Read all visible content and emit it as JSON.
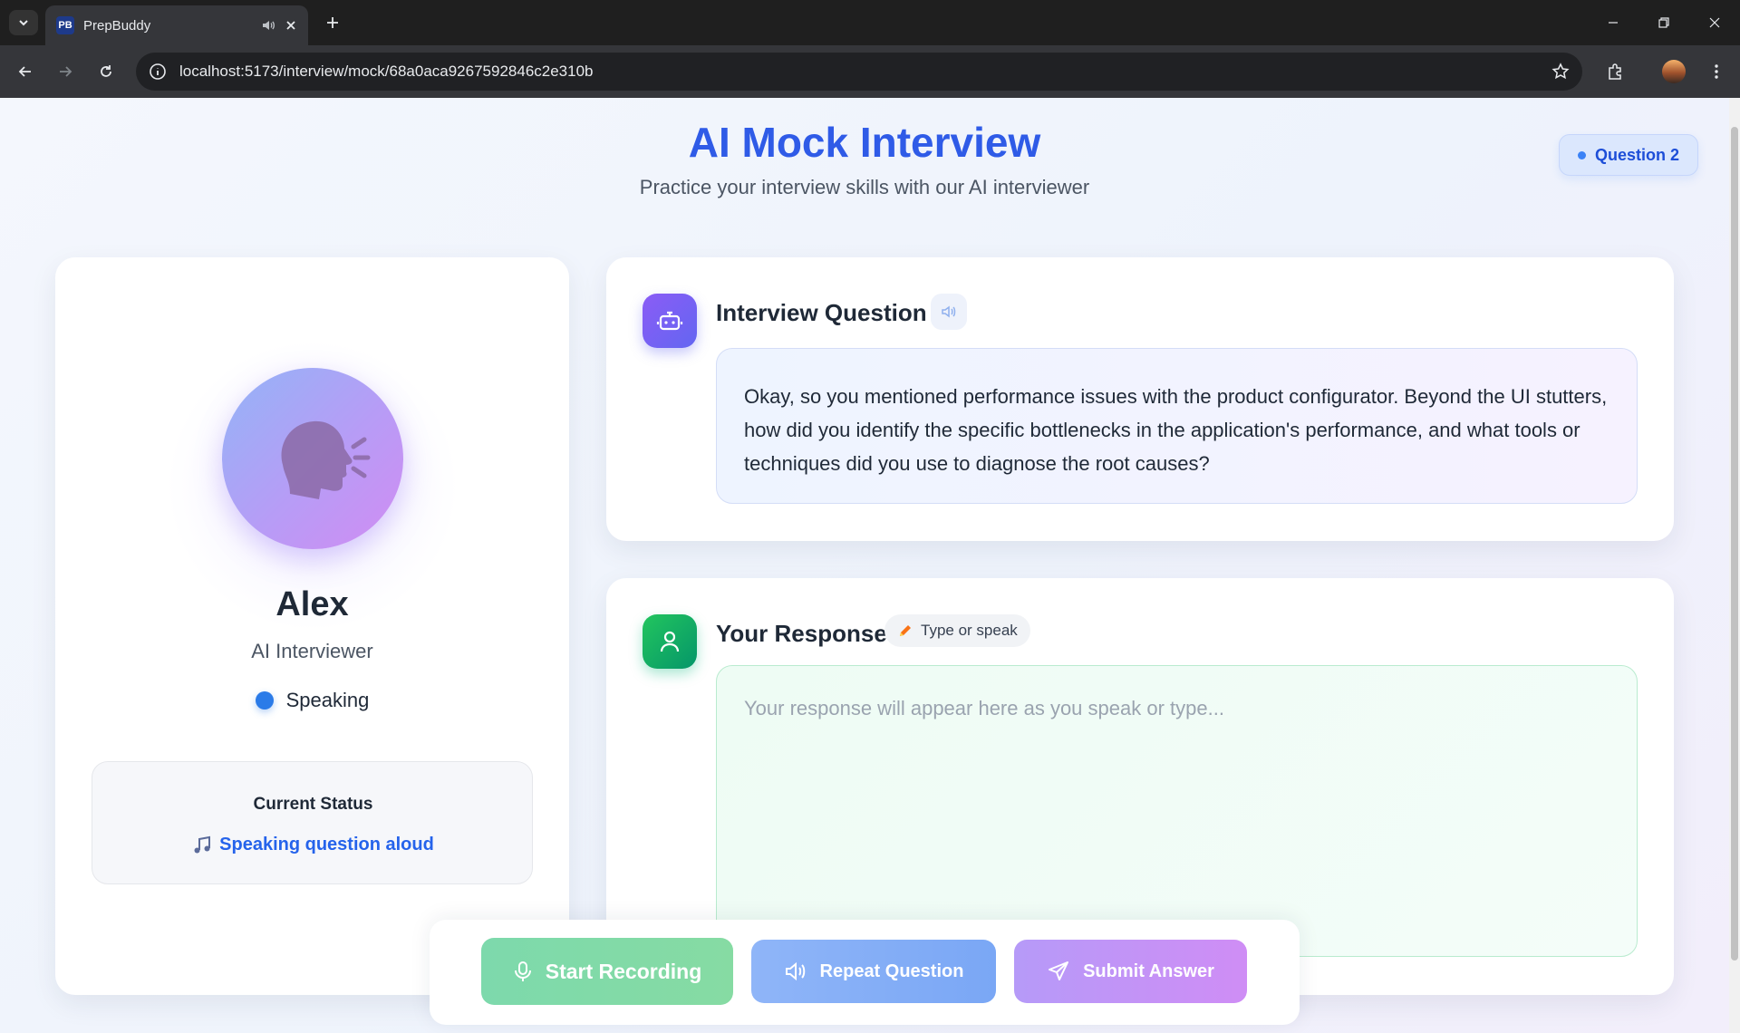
{
  "browser": {
    "tab_title": "PrepBuddy",
    "favicon_text": "PB",
    "url": "localhost:5173/interview/mock/68a0aca9267592846c2e310b"
  },
  "header": {
    "title": "AI Mock Interview",
    "subtitle": "Practice your interview skills with our AI interviewer",
    "question_badge": "Question 2"
  },
  "interviewer": {
    "name": "Alex",
    "role": "AI Interviewer",
    "state": "Speaking",
    "status_title": "Current Status",
    "status_text": "Speaking question aloud"
  },
  "question": {
    "heading": "Interview Question",
    "text": "Okay, so you mentioned performance issues with the product configurator. Beyond the UI stutters, how did you identify the specific bottlenecks in the application's performance, and what tools or techniques did you use to diagnose the root causes?"
  },
  "response": {
    "heading": "Your Response",
    "mode_chip": "Type or speak",
    "placeholder": "Your response will appear here as you speak or type...",
    "value": ""
  },
  "actions": {
    "record": "Start Recording",
    "repeat": "Repeat Question",
    "submit": "Submit Answer"
  },
  "colors": {
    "accent": "#2f5be7",
    "record": "#7dd9ac",
    "repeat": "#8fb5f8",
    "submit": "#c594f6"
  }
}
